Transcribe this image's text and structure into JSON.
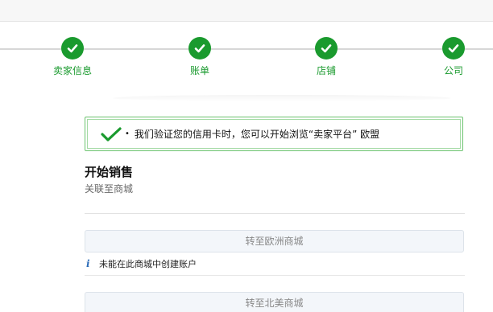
{
  "progress": {
    "steps": [
      {
        "label": "卖家信息",
        "status": "complete"
      },
      {
        "label": "账单",
        "status": "complete"
      },
      {
        "label": "店铺",
        "status": "complete"
      },
      {
        "label": "公司",
        "status": "complete"
      }
    ],
    "accent_color": "#1a9a2e"
  },
  "alert": {
    "text": "我们验证您的信用卡时，您可以开始浏览“卖家平台” 欧盟",
    "icon": "checkmark-icon",
    "bullet": "•"
  },
  "section": {
    "title": "开始销售",
    "subtitle": "关联至商城"
  },
  "marketplaces": {
    "europe_button": "转至欧洲商城",
    "note_icon": "i",
    "note": "未能在此商城中创建账户",
    "north_america_button": "转至北美商城"
  }
}
